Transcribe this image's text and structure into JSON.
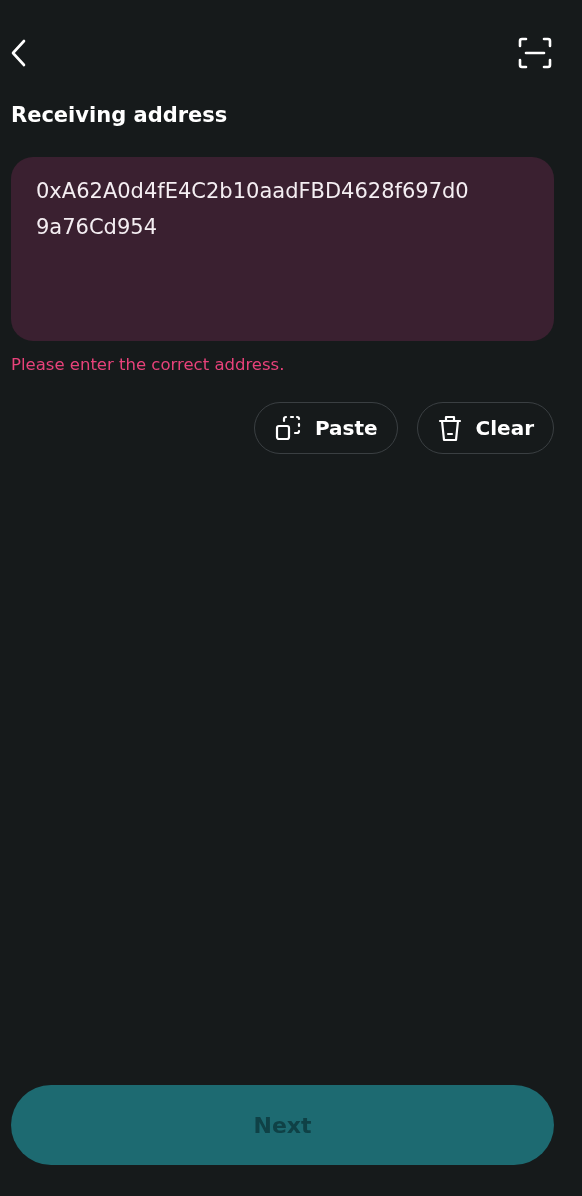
{
  "title": "Receiving address",
  "address_field": {
    "value": "0xA62A0d4fE4C2b10aadFBD4628f697d09a76Cd954",
    "invalid": true
  },
  "error_message": "Please enter the correct address.",
  "actions": [
    {
      "kind": "paste",
      "label": "Paste"
    },
    {
      "kind": "clear",
      "label": "Clear"
    }
  ],
  "next_button": {
    "label": "Next",
    "disabled": true
  }
}
